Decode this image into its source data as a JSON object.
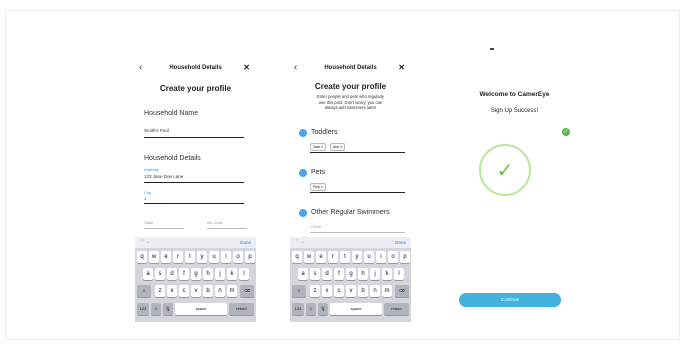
{
  "screens": {
    "profile": {
      "nav_title": "Household Details",
      "back": "‹",
      "close": "✕",
      "heading": "Create your profile",
      "household_name_label": "Household Name",
      "household_name_value": "Smith's Pool",
      "details_label": "Household Details",
      "address_label": "Address",
      "address_value": "123 Jane Doe Lane",
      "city_label": "City",
      "city_value": "1",
      "state_placeholder": "State",
      "zip_placeholder": "Zip Code"
    },
    "swimmers": {
      "nav_title": "Household Details",
      "back": "‹",
      "close": "✕",
      "heading": "Create your profile",
      "description_1": "Enter people and pets who regularly",
      "description_2": "use this pool. Don't worry, you can",
      "description_3": "always add swimmers later!",
      "toddlers_label": "Toddlers",
      "toddler_chips": [
        "Jack ×",
        "Ann ×"
      ],
      "pets_label": "Pets",
      "pet_chips": [
        "Fido ×"
      ],
      "other_label": "Other Regular Swimmers",
      "other_placeholder": "Other"
    },
    "success": {
      "welcome": "Welcome to CamerEye",
      "subtitle": "Sign Up Success!",
      "check": "✓",
      "badge": "✓",
      "continue_label": "Continue"
    }
  },
  "keyboard": {
    "arrows": "⌃ ⌄",
    "done": "Done",
    "row1": [
      "q",
      "w",
      "e",
      "r",
      "t",
      "y",
      "u",
      "i",
      "o",
      "p"
    ],
    "row2": [
      "a",
      "s",
      "d",
      "f",
      "g",
      "h",
      "j",
      "k",
      "l"
    ],
    "row3": [
      "z",
      "x",
      "c",
      "v",
      "b",
      "n",
      "m"
    ],
    "shift": "⇧",
    "backspace": "⌫",
    "num": "123",
    "emoji": "☺",
    "mic": "🎙",
    "space": "space",
    "return": "return"
  },
  "colors": {
    "accent": "#3d8fd8",
    "success": "#6fbf43",
    "continue": "#3fb2dd"
  }
}
